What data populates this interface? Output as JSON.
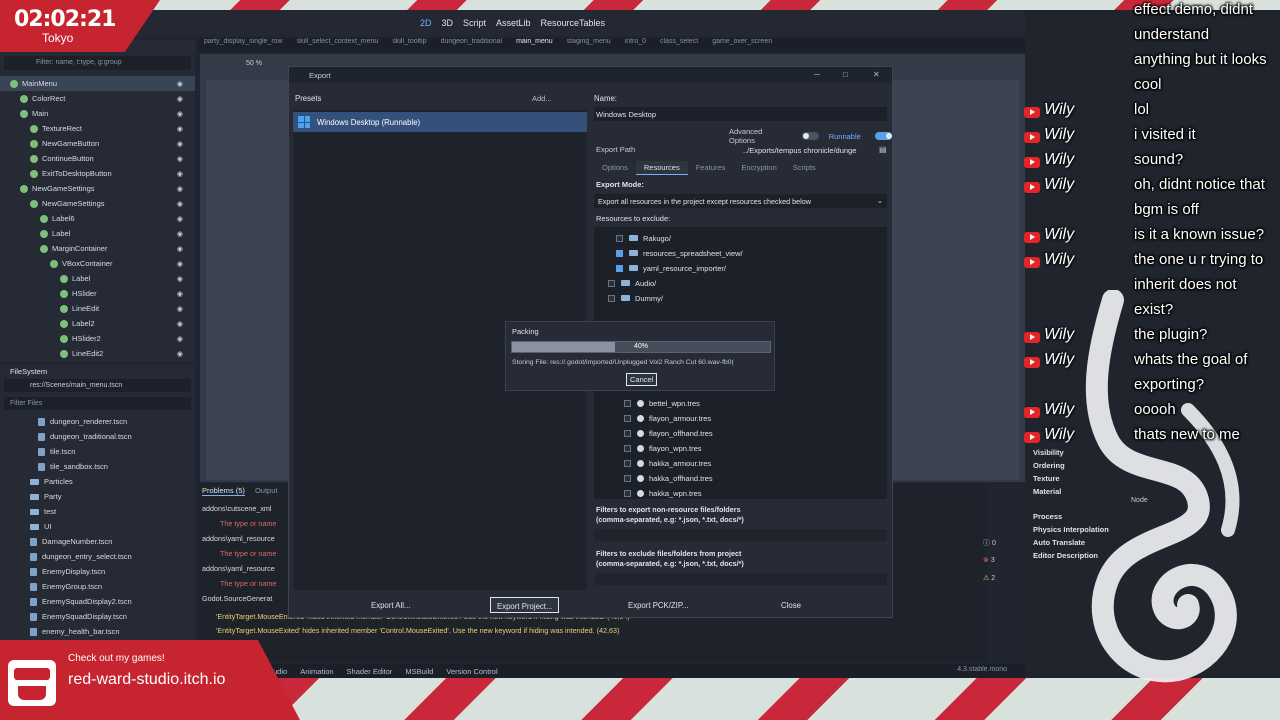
{
  "overlay": {
    "clock_time": "02:02:21",
    "clock_city": "Tokyo",
    "promo_line1": "Check out my games!",
    "promo_line2": "red-ward-studio.itch.io"
  },
  "topbar": {
    "workspaces": [
      {
        "label": "2D",
        "active": true
      },
      {
        "label": "3D"
      },
      {
        "label": "Script"
      },
      {
        "label": "AssetLib"
      },
      {
        "label": "ResourceTables"
      }
    ]
  },
  "scene_tabs": [
    "party_display_single_row",
    "skill_select_context_menu",
    "skill_tooltip",
    "dungeon_traditional",
    "main_menu",
    "staging_menu",
    "intro_0",
    "class_select",
    "game_over_screen"
  ],
  "scene_panel": {
    "filter_placeholder": "Filter: name, t:type, g:group",
    "nodes": [
      {
        "label": "MainMenu",
        "indent": 0,
        "selected": true,
        "color": "#7fc07f"
      },
      {
        "label": "ColorRect",
        "indent": 1,
        "color": "#7fc07f"
      },
      {
        "label": "Main",
        "indent": 1,
        "color": "#7fc07f"
      },
      {
        "label": "TextureRect",
        "indent": 2,
        "color": "#7fc07f"
      },
      {
        "label": "NewGameButton",
        "indent": 2,
        "color": "#7fc07f"
      },
      {
        "label": "ContinueButton",
        "indent": 2,
        "color": "#7fc07f"
      },
      {
        "label": "ExitToDesktopButton",
        "indent": 2,
        "color": "#7fc07f"
      },
      {
        "label": "NewGameSettings",
        "indent": 1,
        "color": "#7fc07f"
      },
      {
        "label": "NewGameSettings",
        "indent": 2,
        "color": "#7fc07f"
      },
      {
        "label": "Label6",
        "indent": 3,
        "color": "#7fc07f"
      },
      {
        "label": "Label",
        "indent": 3,
        "color": "#7fc07f"
      },
      {
        "label": "MarginContainer",
        "indent": 3,
        "color": "#7fc07f"
      },
      {
        "label": "VBoxContainer",
        "indent": 4,
        "color": "#7fc07f"
      },
      {
        "label": "Label",
        "indent": 5,
        "color": "#7fc07f"
      },
      {
        "label": "HSlider",
        "indent": 5,
        "color": "#7fc07f"
      },
      {
        "label": "LineEdit",
        "indent": 5,
        "color": "#7fc07f"
      },
      {
        "label": "Label2",
        "indent": 5,
        "color": "#7fc07f"
      },
      {
        "label": "HSlider2",
        "indent": 5,
        "color": "#7fc07f"
      },
      {
        "label": "LineEdit2",
        "indent": 5,
        "color": "#7fc07f"
      }
    ]
  },
  "filesystem": {
    "title": "FileSystem",
    "path": "res://Scenes/main_menu.tscn",
    "filter_placeholder": "Filter Files",
    "items": [
      {
        "label": "dungeon_renderer.tscn",
        "type": "file",
        "indent": 3
      },
      {
        "label": "dungeon_traditional.tscn",
        "type": "file",
        "indent": 3
      },
      {
        "label": "tile.tscn",
        "type": "file",
        "indent": 3
      },
      {
        "label": "tile_sandbox.tscn",
        "type": "file",
        "indent": 3
      },
      {
        "label": "Particles",
        "type": "folder",
        "indent": 2
      },
      {
        "label": "Party",
        "type": "folder",
        "indent": 2
      },
      {
        "label": "test",
        "type": "folder",
        "indent": 2
      },
      {
        "label": "UI",
        "type": "folder",
        "indent": 2
      },
      {
        "label": "DamageNumber.tscn",
        "type": "file",
        "indent": 2
      },
      {
        "label": "dungeon_entry_select.tscn",
        "type": "file",
        "indent": 2
      },
      {
        "label": "EnemyDisplay.tscn",
        "type": "file",
        "indent": 2
      },
      {
        "label": "EnemyGroup.tscn",
        "type": "file",
        "indent": 2
      },
      {
        "label": "EnemySquadDisplay2.tscn",
        "type": "file",
        "indent": 2
      },
      {
        "label": "EnemySquadDisplay.tscn",
        "type": "file",
        "indent": 2
      },
      {
        "label": "enemy_health_bar.tscn",
        "type": "file",
        "indent": 2
      },
      {
        "label": "enemy_party_display.tscn",
        "type": "file",
        "indent": 2
      }
    ]
  },
  "viewport": {
    "zoom": "50 %"
  },
  "bottom_panel": {
    "tab_problems": "Problems (5)",
    "tab_output": "Output",
    "lines": [
      {
        "text": "addons\\cutscene_xml",
        "kind": "group"
      },
      {
        "text": "The type or name",
        "kind": "err"
      },
      {
        "text": "addons\\yaml_resource",
        "kind": "group"
      },
      {
        "text": "The type or name",
        "kind": "err"
      },
      {
        "text": "addons\\yaml_resource",
        "kind": "group"
      },
      {
        "text": "The type or name",
        "kind": "err"
      },
      {
        "text": "Godot.SourceGenerat",
        "kind": "group"
      }
    ],
    "warn1": "'EntityTarget.MouseEntered' hides inherited member 'Control.MouseEntered'. Use the new keyword if hiding was intended. (40,64)",
    "warn2": "'EntityTarget.MouseExited' hides inherited member 'Control.MouseExited'. Use the new keyword if hiding was intended. (42,63)",
    "counter_info": "0",
    "counter_err": "3",
    "counter_warn": "2"
  },
  "status_bar": {
    "tabs": [
      "Audio",
      "Animation",
      "Shader Editor",
      "MSBuild",
      "Version Control"
    ],
    "version": "4.3.stable.mono"
  },
  "export_dialog": {
    "title": "Export",
    "presets_label": "Presets",
    "add_label": "Add...",
    "preset_name": "Windows Desktop (Runnable)",
    "name_label": "Name:",
    "name_value": "Windows Desktop",
    "advanced_options": "Advanced Options",
    "runnable": "Runnable",
    "export_path_label": "Export Path",
    "export_path": "../Exports/tempus chronicle/dunge",
    "tabs": [
      "Options",
      "Resources",
      "Features",
      "Encryption",
      "Scripts"
    ],
    "export_mode_label": "Export Mode:",
    "export_mode_value": "Export all resources in the project except resources checked below",
    "resources_exclude_label": "Resources to exclude:",
    "tree_items": [
      {
        "label": "Rakugo/",
        "checked": false,
        "indent": 2,
        "kind": "folder",
        "row": 0
      },
      {
        "label": "resources_spreadsheet_view/",
        "checked": true,
        "indent": 2,
        "kind": "folder",
        "row": 1
      },
      {
        "label": "yaml_resource_importer/",
        "checked": true,
        "indent": 2,
        "kind": "folder",
        "row": 2
      },
      {
        "label": "Audio/",
        "checked": false,
        "indent": 1,
        "kind": "folder",
        "row": 3
      },
      {
        "label": "Dummy/",
        "checked": false,
        "indent": 1,
        "kind": "folder",
        "row": 4
      },
      {
        "label": "bettel_wpn.tres",
        "checked": false,
        "indent": 3,
        "kind": "res",
        "row": 11
      },
      {
        "label": "flayon_armour.tres",
        "checked": false,
        "indent": 3,
        "kind": "res",
        "row": 12
      },
      {
        "label": "flayon_offhand.tres",
        "checked": false,
        "indent": 3,
        "kind": "res",
        "row": 13
      },
      {
        "label": "flayon_wpn.tres",
        "checked": false,
        "indent": 3,
        "kind": "res",
        "row": 14
      },
      {
        "label": "hakka_armour.tres",
        "checked": false,
        "indent": 3,
        "kind": "res",
        "row": 15
      },
      {
        "label": "hakka_offhand.tres",
        "checked": false,
        "indent": 3,
        "kind": "res",
        "row": 16
      },
      {
        "label": "hakka_wpn.tres",
        "checked": false,
        "indent": 3,
        "kind": "res",
        "row": 17
      }
    ],
    "filter_nonres_label": "Filters to export non-resource files/folders",
    "filter_nonres_hint": "(comma-separated, e.g: *.json, *.txt, docs/*)",
    "filter_exclude_label": "Filters to exclude files/folders from project",
    "filter_exclude_hint": "(comma-separated, e.g: *.json, *.txt, docs/*)",
    "btn_export_all": "Export All...",
    "btn_export_project": "Export Project...",
    "btn_export_pck": "Export PCK/ZIP...",
    "btn_close": "Close"
  },
  "packing": {
    "title": "Packing",
    "progress": 0.4,
    "progress_label": "40%",
    "file": "Storing File: res://.godot/imported/Unplugged Vol2 Ranch Cut 60.wav-fb0(",
    "cancel": "Cancel"
  },
  "inspector": {
    "sections": [
      "Visibility",
      "Ordering",
      "Texture",
      "Material",
      "Process",
      "Physics Interpolation",
      "Auto Translate",
      "Editor Description"
    ],
    "node_label": "Node"
  },
  "chat": {
    "username": "Wily",
    "lines": [
      {
        "text": "effect demo, didnt",
        "user": false
      },
      {
        "text": "understand",
        "user": false
      },
      {
        "text": "anything but it looks",
        "user": false
      },
      {
        "text": "cool",
        "user": false
      },
      {
        "text": "lol",
        "user": true
      },
      {
        "text": "i visited it",
        "user": true
      },
      {
        "text": "sound?",
        "user": true
      },
      {
        "text": "oh, didnt notice that",
        "user": true
      },
      {
        "text": "bgm is off",
        "user": false
      },
      {
        "text": "is it a known issue?",
        "user": true
      },
      {
        "text": "the one u r trying to",
        "user": true
      },
      {
        "text": "inherit does not",
        "user": false
      },
      {
        "text": "exist?",
        "user": false
      },
      {
        "text": "the plugin?",
        "user": true
      },
      {
        "text": "whats the goal of",
        "user": true
      },
      {
        "text": "exporting?",
        "user": false
      },
      {
        "text": "ooooh",
        "user": true
      },
      {
        "text": "thats new to me",
        "user": true
      }
    ]
  }
}
